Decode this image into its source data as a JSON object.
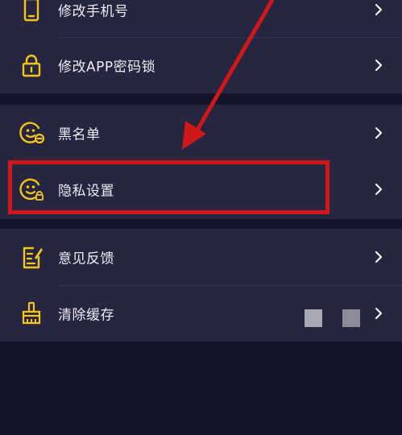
{
  "settings": {
    "groups": [
      {
        "items": [
          {
            "label": "修改手机号",
            "icon": "phone-icon"
          },
          {
            "label": "修改APP密码锁",
            "icon": "lock-icon"
          }
        ]
      },
      {
        "items": [
          {
            "label": "黑名单",
            "icon": "blocklist-smiley-icon"
          },
          {
            "label": "隐私设置",
            "icon": "privacy-smiley-icon"
          }
        ]
      },
      {
        "items": [
          {
            "label": "意见反馈",
            "icon": "feedback-edit-icon"
          },
          {
            "label": "清除缓存",
            "icon": "broom-icon"
          }
        ]
      }
    ]
  },
  "colors": {
    "background": "#14142a",
    "row_background": "#262641",
    "icon_accent": "#f5c518",
    "highlight": "#d0181b",
    "chevron": "#ffffff"
  }
}
